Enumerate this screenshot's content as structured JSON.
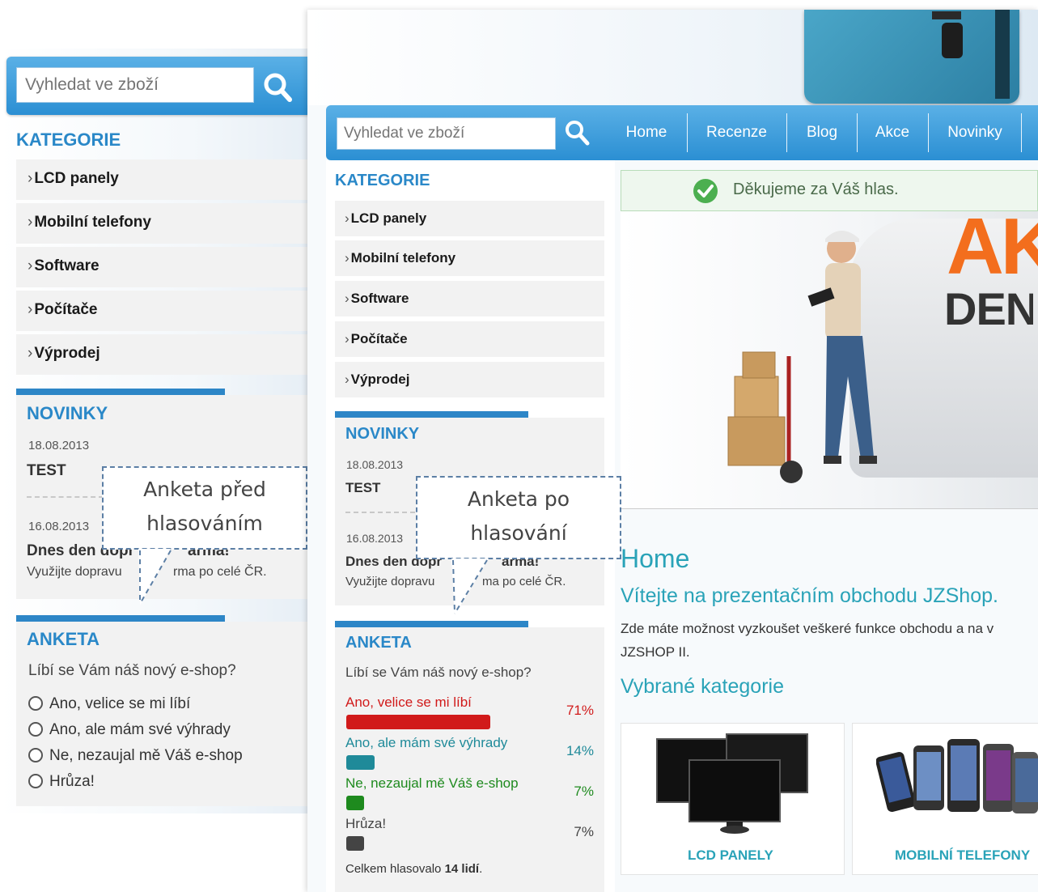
{
  "before": {
    "search_placeholder": "Vyhledat ve zboží",
    "categories_heading": "KATEGORIE",
    "categories": [
      "LCD panely",
      "Mobilní telefony",
      "Software",
      "Počítače",
      "Výprodej"
    ],
    "news_heading": "NOVINKY",
    "news": [
      {
        "date": "18.08.2013",
        "title": "TEST"
      },
      {
        "date": "16.08.2013",
        "title": "Dnes den dopr",
        "title_tail": "arma!",
        "desc": "Využijte dopravu",
        "desc_tail": "rma po celé ČR."
      }
    ],
    "poll_heading": "ANKETA",
    "poll_question": "Líbí se Vám náš nový e-shop?",
    "poll_options": [
      "Ano, velice se mi líbí",
      "Ano, ale mám své výhrady",
      "Ne, nezaujal mě Váš e-shop",
      "Hrůza!"
    ],
    "callout": [
      "Anketa před",
      "hlasováním"
    ]
  },
  "after": {
    "search_placeholder": "Vyhledat ve zboží",
    "nav": [
      "Home",
      "Recenze",
      "Blog",
      "Akce",
      "Novinky"
    ],
    "categories_heading": "KATEGORIE",
    "categories": [
      "LCD panely",
      "Mobilní telefony",
      "Software",
      "Počítače",
      "Výprodej"
    ],
    "news_heading": "NOVINKY",
    "news": [
      {
        "date": "18.08.2013",
        "title": "TEST"
      },
      {
        "date": "16.08.2013",
        "title": "Dnes den dopr",
        "title_tail": "arma!",
        "desc": "Využijte dopravu",
        "desc_tail": "ma po celé ČR."
      }
    ],
    "poll_heading": "ANKETA",
    "poll_question": "Líbí se Vám náš nový e-shop?",
    "poll_results": [
      {
        "label": "Ano, velice se mi líbí",
        "percent": "71%",
        "value": 71,
        "color": "#d11a1a"
      },
      {
        "label": "Ano, ale mám své výhrady",
        "percent": "14%",
        "value": 14,
        "color": "#1f8a99"
      },
      {
        "label": "Ne, nezaujal mě Váš e-shop",
        "percent": "7%",
        "value": 7,
        "color": "#1e8a1e"
      },
      {
        "label": "Hrůza!",
        "percent": "7%",
        "value": 7,
        "color": "#444444"
      }
    ],
    "poll_total_prefix": "Celkem hlasovalo",
    "poll_total_count": "14 lidí",
    "poll_total_suffix": ".",
    "thanks_message": "Děkujeme za Váš hlas.",
    "banner_big": "AKCE",
    "banner_small": "DEN",
    "home_title": "Home",
    "welcome": "Vítejte na prezentačním obchodu JZShop.",
    "intro_line1": "Zde máte možnost vyzkoušet veškeré funkce obchodu a na v",
    "intro_line2": "JZSHOP II.",
    "featured_title": "Vybrané kategorie",
    "featured": [
      "LCD PANELY",
      "MOBILNÍ TELEFONY"
    ],
    "callout": [
      "Anketa po",
      "hlasování"
    ]
  },
  "colors": {
    "accent": "#2a88c8",
    "nav": "#2b8fd3",
    "teal": "#2aa3b8",
    "success": "#4caf50"
  }
}
